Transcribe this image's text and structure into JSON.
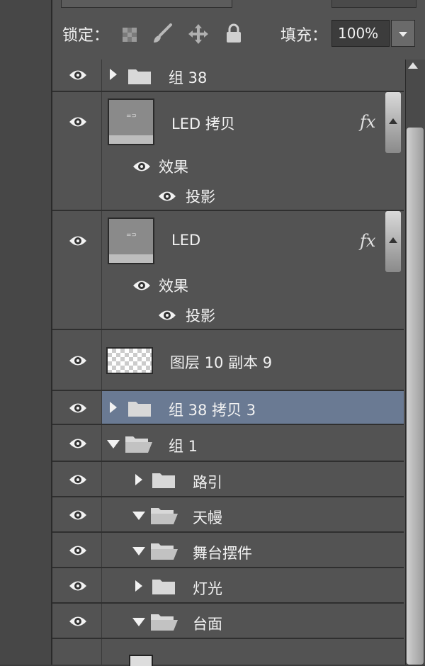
{
  "toolbar": {
    "lock_label": "锁定：",
    "fill_label": "填充：",
    "fill_value": "100%"
  },
  "layers": [
    {
      "name": "组 38",
      "kind": "group",
      "expanded": false
    },
    {
      "name": "LED 拷贝",
      "kind": "layer",
      "fx": "fx",
      "effects_label": "效果",
      "effect": "投影"
    },
    {
      "name": "LED",
      "kind": "layer",
      "fx": "fx",
      "effects_label": "效果",
      "effect": "投影"
    },
    {
      "name": "图层 10 副本 9",
      "kind": "pixel"
    },
    {
      "name": "组 38 拷贝 3",
      "kind": "group",
      "expanded": false,
      "selected": true
    },
    {
      "name": "组 1",
      "kind": "group",
      "expanded": true
    },
    {
      "name": "路引",
      "kind": "group",
      "expanded": false,
      "indent": 1
    },
    {
      "name": "天幔",
      "kind": "group",
      "expanded": true,
      "indent": 1
    },
    {
      "name": "舞台摆件",
      "kind": "group",
      "expanded": true,
      "indent": 1
    },
    {
      "name": "灯光",
      "kind": "group",
      "expanded": false,
      "indent": 1
    },
    {
      "name": "台面",
      "kind": "group",
      "expanded": true,
      "indent": 1
    }
  ],
  "colors": {
    "panel": "#535353",
    "selection": "#6a7a93",
    "divider": "#2f2f2f"
  },
  "icons": [
    "eye-icon",
    "folder-icon",
    "folder-open-icon",
    "triangle-right-icon",
    "triangle-down-icon",
    "lock-transparent-icon",
    "lock-brush-icon",
    "lock-move-icon",
    "lock-all-icon",
    "dropdown-icon",
    "scroll-up-icon"
  ]
}
